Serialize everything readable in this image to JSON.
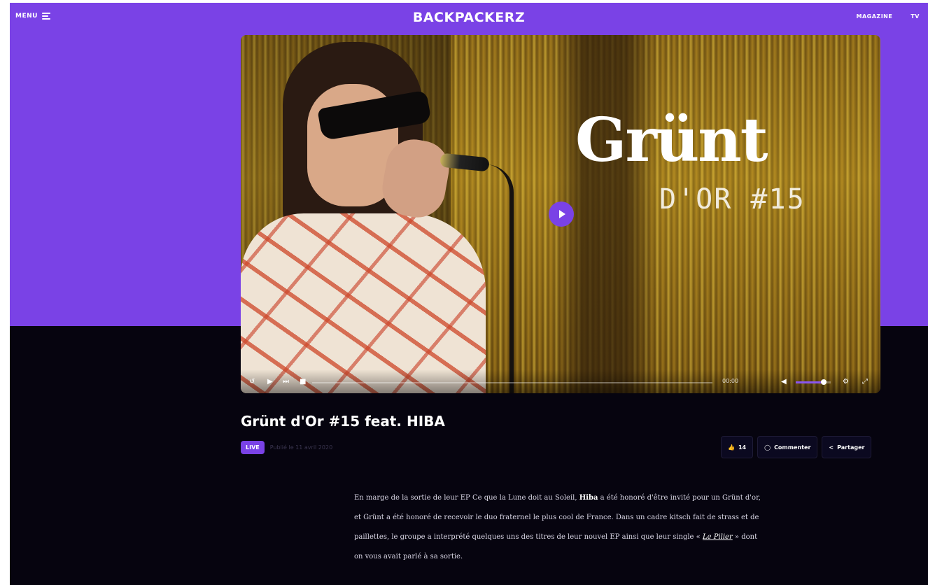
{
  "header": {
    "menu_label": "MENU",
    "logo": "BACKPACKERZ",
    "nav": [
      "MAGAZINE",
      "TV"
    ]
  },
  "video": {
    "overlay_title": "Grünt",
    "overlay_subtitle": "D'OR #15",
    "icons": [
      "play-icon",
      "skip-icon",
      "replay-icon",
      "volume-icon",
      "settings-icon",
      "fullscreen-icon"
    ],
    "time": "00:00",
    "volume_level": 0.8
  },
  "post": {
    "title": "Grünt d'Or #15 feat. HIBA",
    "badge": "LIVE",
    "date": "Publié le 11 avril 2020"
  },
  "actions": {
    "likes_label": "14",
    "comment_label": "Commenter",
    "share_label": "Partager"
  },
  "article": {
    "p1_a": "En marge de la sortie de leur EP Ce que la Lune doit au Soleil, ",
    "p1_b": "Hiba",
    "p1_c": " a été honoré d'être invité pour un Grünt d'or, et Grünt a été honoré de recevoir le duo fraternel le plus cool de France. Dans un cadre kitsch fait de strass et de paillettes, le groupe a interprété quelques uns des titres de leur nouvel EP ainsi que leur single « ",
    "p1_link": "Le Pilier",
    "p1_d": " » dont on vous avait parlé à sa sortie."
  },
  "colors": {
    "brand": "#7a42e6",
    "background": "#06040f"
  }
}
